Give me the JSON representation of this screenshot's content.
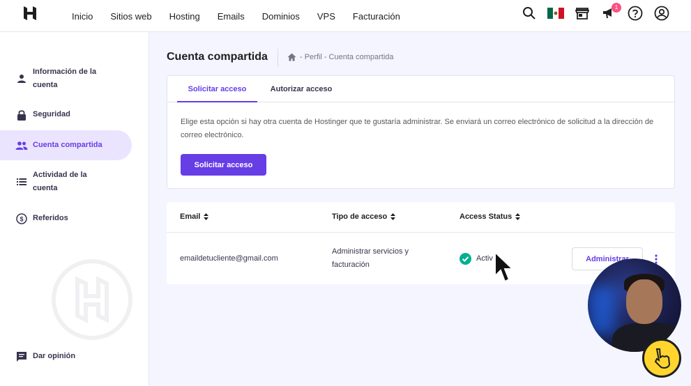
{
  "nav": {
    "items": [
      "Inicio",
      "Sitios web",
      "Hosting",
      "Emails",
      "Dominios",
      "VPS",
      "Facturación"
    ],
    "notification_count": "1"
  },
  "icons": {
    "logo": "hostinger-logo-icon",
    "search": "search-icon",
    "flag": "mexico-flag-icon",
    "store": "store-icon",
    "announcements": "megaphone-icon",
    "help": "help-icon",
    "account": "account-icon"
  },
  "sidebar": {
    "items": [
      {
        "label": "Información de la cuenta",
        "icon": "person-icon"
      },
      {
        "label": "Seguridad",
        "icon": "lock-icon"
      },
      {
        "label": "Cuenta compartida",
        "icon": "people-icon",
        "active": true
      },
      {
        "label": "Actividad de la cuenta",
        "icon": "list-icon"
      },
      {
        "label": "Referidos",
        "icon": "dollar-icon"
      }
    ],
    "feedback": "Dar opinión"
  },
  "page": {
    "title": "Cuenta compartida",
    "breadcrumb": "- Perfil - Cuenta compartida"
  },
  "request_card": {
    "tabs": [
      "Solicitar acceso",
      "Autorizar acceso"
    ],
    "active_tab": 0,
    "description": "Elige esta opción si hay otra cuenta de Hostinger que te gustaría administrar. Se enviará un correo electrónico de solicitud a la dirección de correo electrónico.",
    "button": "Solicitar acceso"
  },
  "table": {
    "headers": [
      "Email",
      "Tipo de acceso",
      "Access Status"
    ],
    "rows": [
      {
        "email": "emaildetucliente@gmail.com",
        "access_type": "Administrar servicios y facturación",
        "status": "Activ",
        "action": "Administrar"
      }
    ]
  },
  "colors": {
    "primary": "#673de6",
    "active_bg": "#ebe4ff",
    "success": "#00b090",
    "page_bg": "#f4f5ff"
  }
}
